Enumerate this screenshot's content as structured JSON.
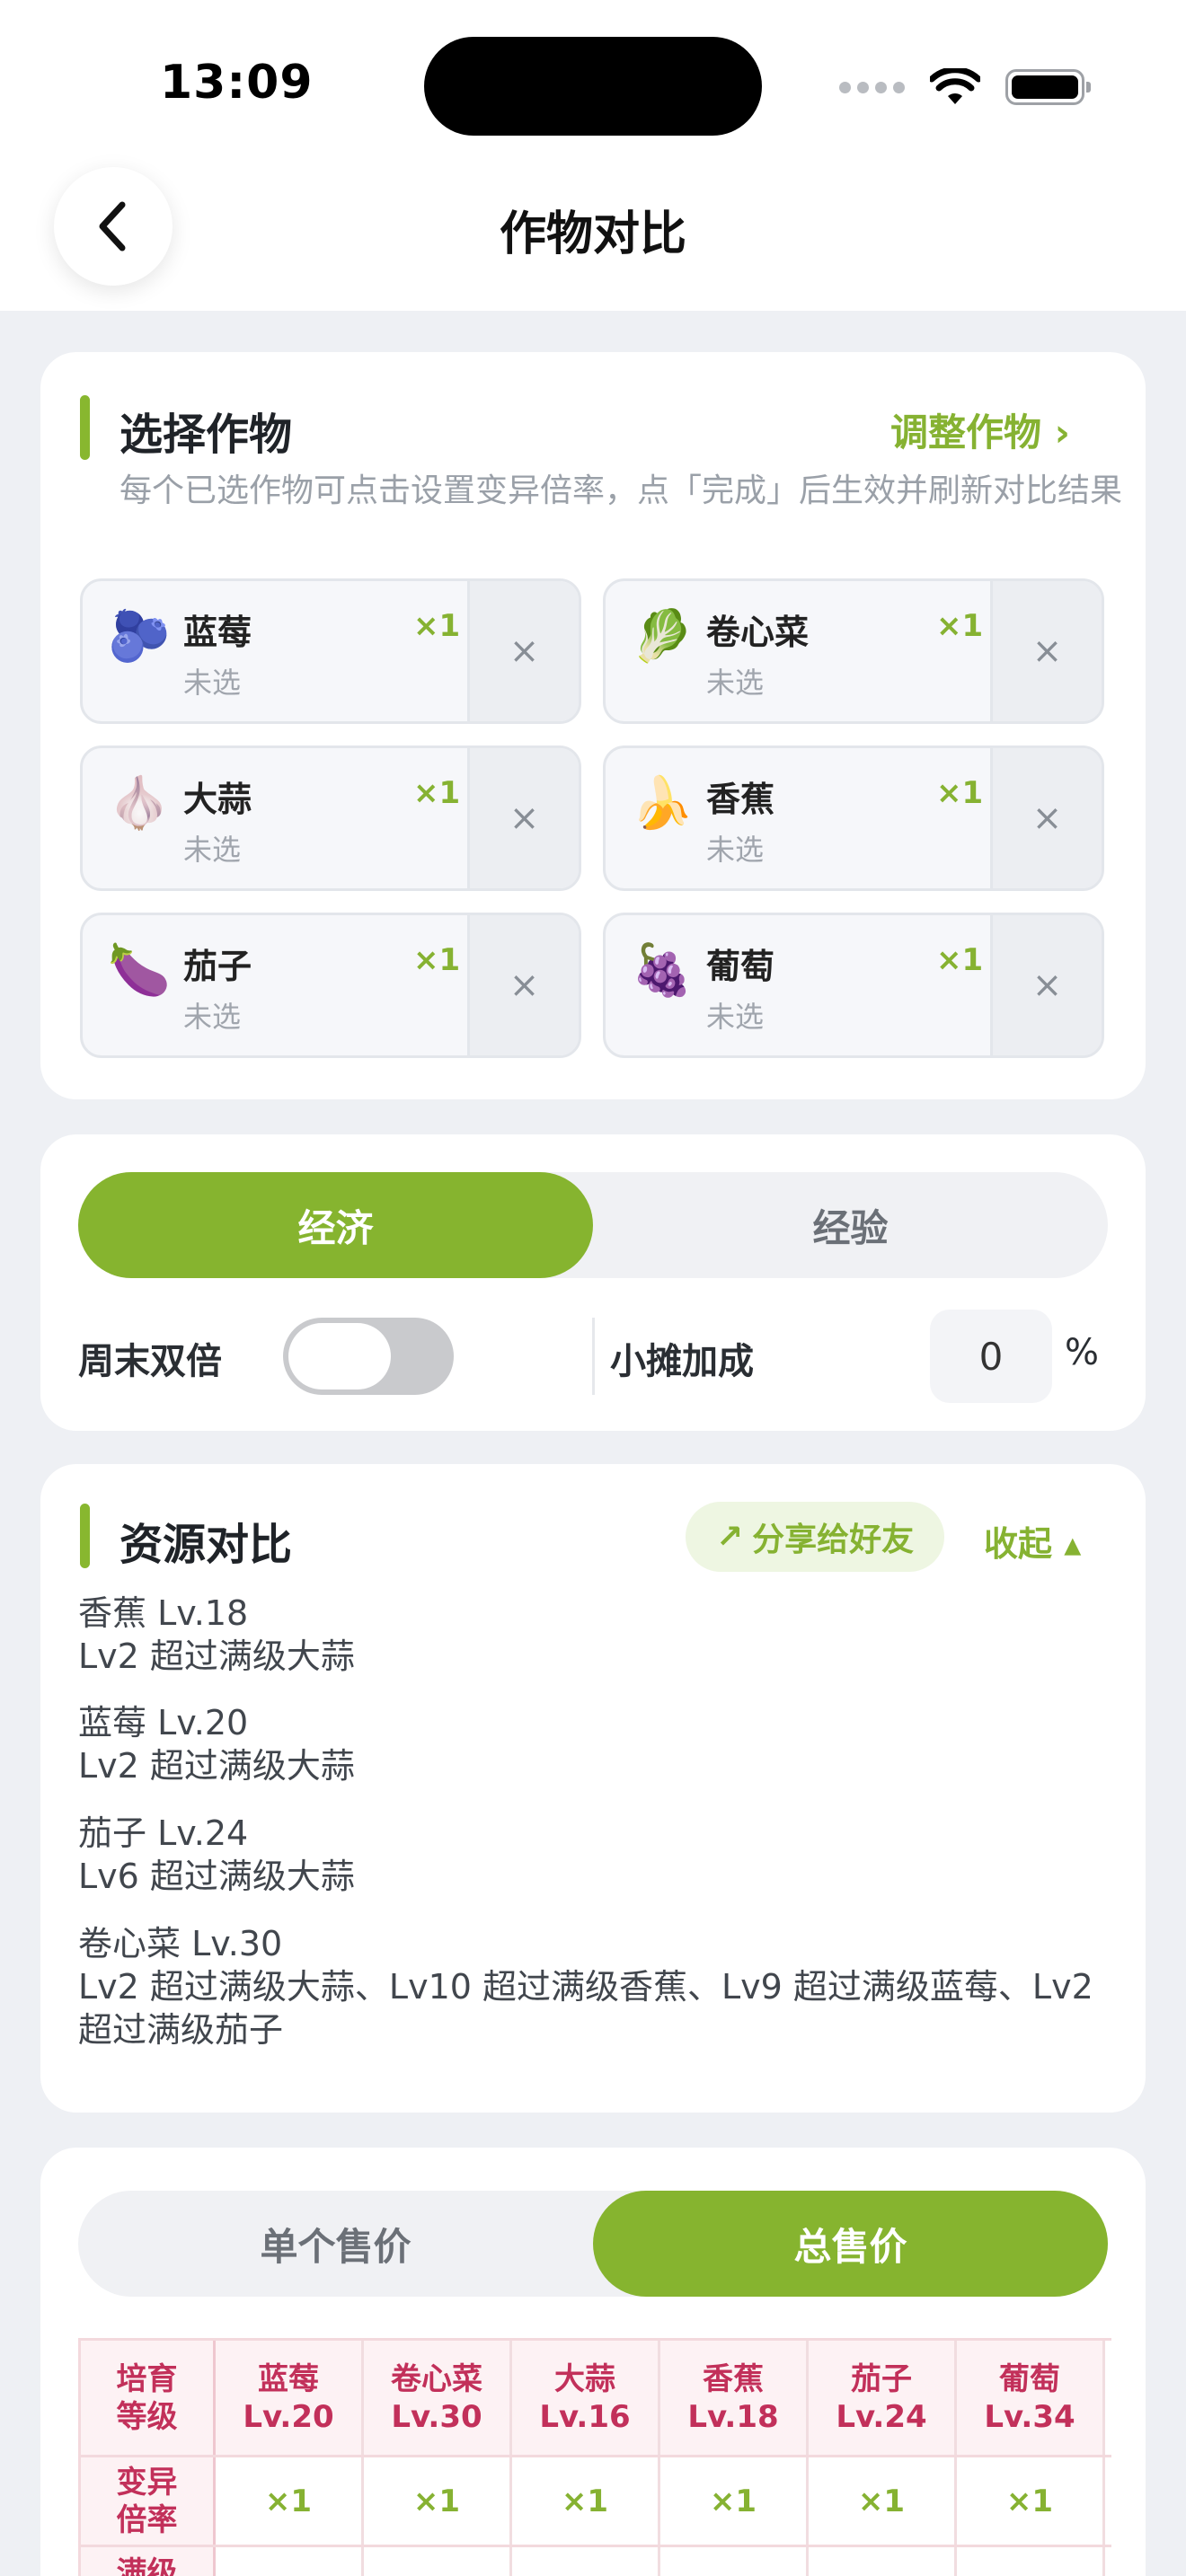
{
  "status_bar": {
    "time": "13:09"
  },
  "header": {
    "title": "作物对比",
    "back_icon": "chevron-left-icon"
  },
  "select_crops": {
    "title": "选择作物",
    "adjust_link": "调整作物 ›",
    "hint": "每个已选作物可点击设置变异倍率，点「完成」后生效并刷新对比结果",
    "crops": [
      {
        "emoji": "🫐",
        "name": "蓝莓",
        "sub": "未选",
        "mult": "×1"
      },
      {
        "emoji": "🥬",
        "name": "卷心菜",
        "sub": "未选",
        "mult": "×1"
      },
      {
        "emoji": "🧄",
        "name": "大蒜",
        "sub": "未选",
        "mult": "×1"
      },
      {
        "emoji": "🍌",
        "name": "香蕉",
        "sub": "未选",
        "mult": "×1"
      },
      {
        "emoji": "🍆",
        "name": "茄子",
        "sub": "未选",
        "mult": "×1"
      },
      {
        "emoji": "🍇",
        "name": "葡萄",
        "sub": "未选",
        "mult": "×1"
      }
    ],
    "remove_glyph": "×"
  },
  "mode": {
    "tabs": [
      "经济",
      "经验"
    ],
    "active_index": 0,
    "weekend_label": "周末双倍",
    "weekend_on": false,
    "stall_label": "小摊加成",
    "stall_value": "0",
    "stall_unit": "%"
  },
  "resources": {
    "title": "资源对比",
    "share_label": "分享给好友",
    "share_icon": "arrow-up-right-icon",
    "collapse_label": "收起 ▴",
    "items": [
      {
        "head": "香蕉 Lv.18",
        "body": "Lv2 超过满级大蒜"
      },
      {
        "head": "蓝莓 Lv.20",
        "body": "Lv2 超过满级大蒜"
      },
      {
        "head": "茄子 Lv.24",
        "body": "Lv6 超过满级大蒜"
      },
      {
        "head": "卷心菜 Lv.30",
        "body": "Lv2 超过满级大蒜、Lv10 超过满级香蕉、Lv9 超过满级蓝莓、Lv2 超过满级茄子"
      }
    ]
  },
  "price": {
    "tabs": [
      "单个售价",
      "总售价"
    ],
    "active_index": 1,
    "table": {
      "corner": "培育\n等级",
      "columns": [
        "蓝莓\nLv.20",
        "卷心菜\nLv.30",
        "大蒜\nLv.16",
        "香蕉\nLv.18",
        "茄子\nLv.24",
        "葡萄\nLv.34"
      ],
      "rows": [
        {
          "label": "变异\n倍率",
          "values": [
            "×1",
            "×1",
            "×1",
            "×1",
            "×1",
            "×1"
          ]
        },
        {
          "label": "满级",
          "values": [
            "",
            "",
            "",
            "",
            "",
            ""
          ]
        }
      ]
    }
  },
  "colors": {
    "accent": "#86b232",
    "table_header": "#c2305a"
  }
}
